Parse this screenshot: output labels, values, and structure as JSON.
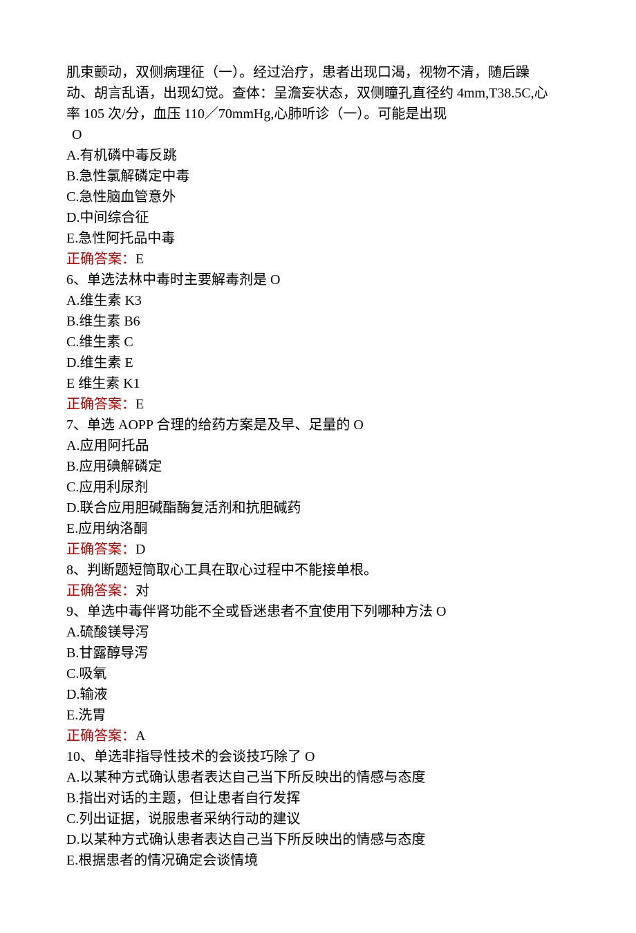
{
  "q5": {
    "stem_lines": [
      "肌束颤动，双侧病理征（一）。经过治疗，患者出现口渴，视物不清，随后躁",
      "动、胡言乱语，出现幻觉。查体：呈澹妄状态，双侧瞳孔直径约 4mm,T38.5C,心",
      "率 105 次/分，血压 110／70mmHg,心肺听诊（一）。可能是出现"
    ],
    "stem_tail": "O",
    "opt_a": "A.有机磷中毒反跳",
    "opt_b": "B.急性氯解磷定中毒",
    "opt_c": "C.急性脑血管意外",
    "opt_d": "D.中间综合征",
    "opt_e": "E.急性阿托品中毒",
    "answer_label": "正确答案：",
    "answer_value": "E"
  },
  "q6": {
    "stem": "6、单选法林中毒时主要解毒剂是 O",
    "opt_a": "A.维生素 K3",
    "opt_b": "B.维生素 B6",
    "opt_c": "C.维生素 C",
    "opt_d": "D.维生素 E",
    "opt_e": "E 维生素 K1",
    "answer_label": "正确答案：",
    "answer_value": "E"
  },
  "q7": {
    "stem": "7、单选 AOPP 合理的给药方案是及早、足量的 O",
    "opt_a": "A.应用阿托品",
    "opt_b": "B.应用碘解磷定",
    "opt_c": "C.应用利尿剂",
    "opt_d": "D.联合应用胆碱酯酶复活剂和抗胆碱药",
    "opt_e": "E.应用纳洛酮",
    "answer_label": "正确答案：",
    "answer_value": "D"
  },
  "q8": {
    "stem": "8、判断题短筒取心工具在取心过程中不能接单根。",
    "answer_label": "正确答案：",
    "answer_value": "对"
  },
  "q9": {
    "stem": "9、单选中毒伴肾功能不全或昏迷患者不宜使用下列哪种方法 O",
    "opt_a": "A.硫酸镁导泻",
    "opt_b": "B.甘露醇导泻",
    "opt_c": "C.吸氧",
    "opt_d": "D.输液",
    "opt_e": "E.洗胃",
    "answer_label": "正确答案：",
    "answer_value": "A"
  },
  "q10": {
    "stem": "10、单选非指导性技术的会谈技巧除了 O",
    "opt_a": "A.以某种方式确认患者表达自己当下所反映出的情感与态度",
    "opt_b": "B.指出对话的主题，但让患者自行发挥",
    "opt_c": "C.列出证据，说服患者采纳行动的建议",
    "opt_d": "D.以某种方式确认患者表达自己当下所反映出的情感与态度",
    "opt_e": "E.根据患者的情况确定会谈情境"
  }
}
